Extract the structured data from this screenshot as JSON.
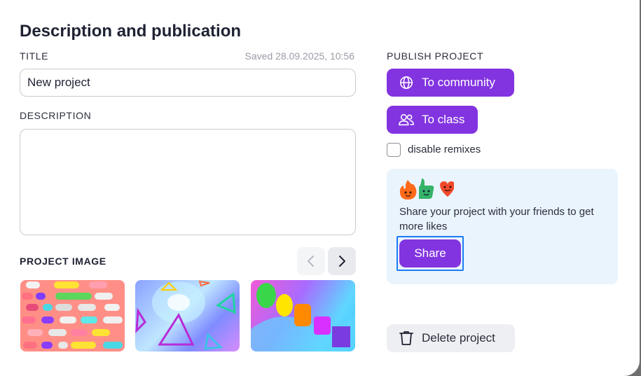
{
  "dialog": {
    "title": "Description and publication"
  },
  "left": {
    "title_label": "TITLE",
    "saved_text": "Saved 28.09.2025, 10:56",
    "title_value": "New project",
    "description_label": "DESCRIPTION",
    "description_value": "",
    "image_label": "PROJECT IMAGE",
    "thumbnails": [
      "thumbnail-capsules",
      "thumbnail-neon-shapes",
      "thumbnail-gradient-shapes"
    ]
  },
  "right": {
    "publish_label": "PUBLISH PROJECT",
    "to_community_label": "To community",
    "to_class_label": "To class",
    "disable_remixes_label": "disable remixes",
    "disable_remixes_checked": false,
    "share_card": {
      "text": "Share your project with your friends to get more likes",
      "share_label": "Share",
      "emojis": [
        "fire-emoji",
        "thumbs-up-emoji",
        "heart-emoji"
      ]
    },
    "delete_label": "Delete project"
  },
  "colors": {
    "accent": "#8234e0",
    "share_card_bg": "#eaf4fd",
    "focus_ring": "#1b7cf5"
  }
}
